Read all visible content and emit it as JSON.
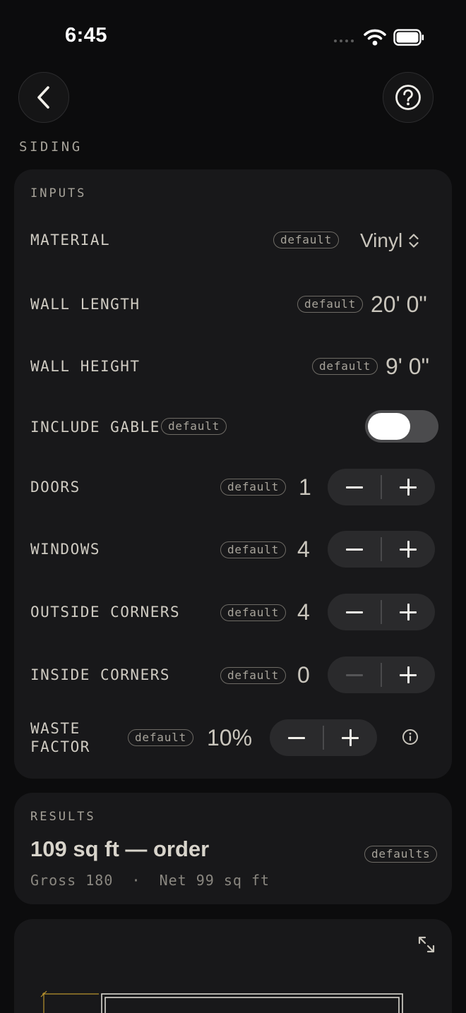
{
  "status_bar": {
    "time": "6:45"
  },
  "header": {
    "back_icon": "chevron-left-icon",
    "help_icon": "question-circle-icon",
    "title": "SIDING"
  },
  "inputs": {
    "section_label": "INPUTS",
    "material": {
      "label": "MATERIAL",
      "badge": "default",
      "value": "Vinyl",
      "icon": "chevron-up-down-icon"
    },
    "wall_length": {
      "label": "WALL LENGTH",
      "badge": "default",
      "value": "20' 0\""
    },
    "wall_height": {
      "label": "WALL HEIGHT",
      "badge": "default",
      "value": "9' 0\""
    },
    "include_gable": {
      "label": "INCLUDE GABLE",
      "badge": "default",
      "on": true
    },
    "doors": {
      "label": "DOORS",
      "badge": "default",
      "value": "1"
    },
    "windows": {
      "label": "WINDOWS",
      "badge": "default",
      "value": "4"
    },
    "outside_corners": {
      "label": "OUTSIDE CORNERS",
      "badge": "default",
      "value": "4"
    },
    "inside_corners": {
      "label": "INSIDE CORNERS",
      "badge": "default",
      "value": "0",
      "minus_disabled": true
    },
    "waste_factor": {
      "label_line1": "WASTE",
      "label_line2": "FACTOR",
      "badge": "default",
      "value": "10%",
      "info_icon": "info-circle-icon"
    }
  },
  "results": {
    "section_label": "RESULTS",
    "headline": "109 sq ft — order",
    "badge": "defaults",
    "detail": "Gross 180  ·  Net 99 sq ft"
  },
  "diagram": {
    "expand_icon": "expand-arrows-icon"
  },
  "colors": {
    "background": "#0c0c0d",
    "card": "#18181a",
    "stepper": "#2a2a2c",
    "accent_line": "#b8932f"
  }
}
